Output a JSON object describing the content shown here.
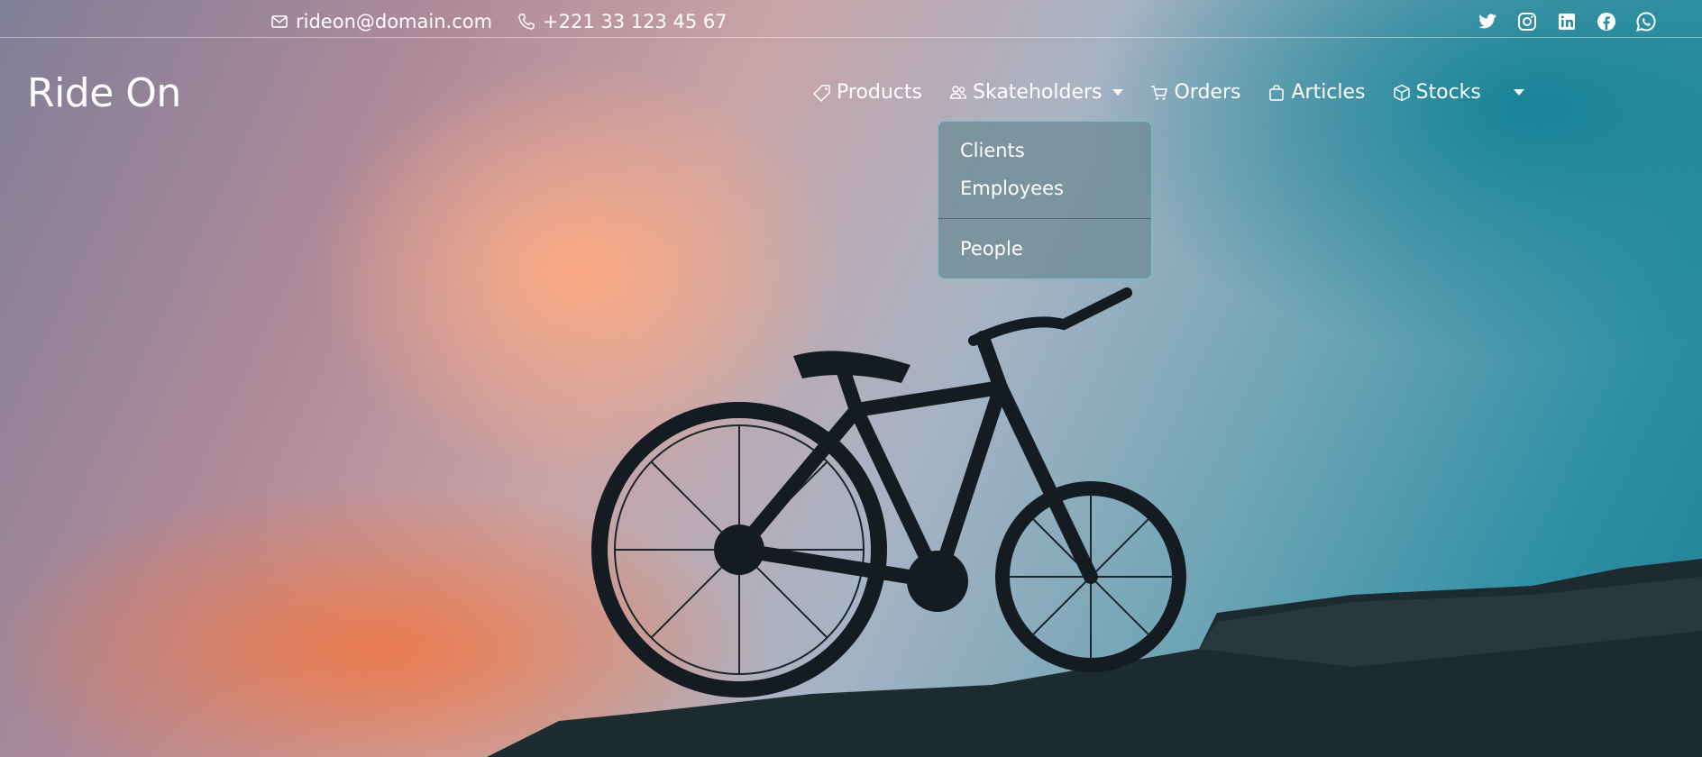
{
  "topbar": {
    "email": "rideon@domain.com",
    "phone": "+221 33 123 45 67",
    "social_icons": [
      "twitter-icon",
      "instagram-icon",
      "linkedin-icon",
      "facebook-icon",
      "whatsapp-icon"
    ]
  },
  "brand": {
    "name": "Ride On"
  },
  "nav": {
    "items": [
      {
        "label": "Products",
        "icon": "tag-icon"
      },
      {
        "label": "Skateholders",
        "icon": "users-icon",
        "dropdown": true
      },
      {
        "label": "Orders",
        "icon": "cart-icon"
      },
      {
        "label": "Articles",
        "icon": "bag-icon"
      },
      {
        "label": "Stocks",
        "icon": "box-icon"
      }
    ]
  },
  "dropdown": {
    "items": [
      "Clients",
      "Employees"
    ],
    "footer_item": "People"
  },
  "colors": {
    "text": "#ffffff",
    "sky_teal": "#1f7f96",
    "sunset_orange": "#f08046"
  }
}
